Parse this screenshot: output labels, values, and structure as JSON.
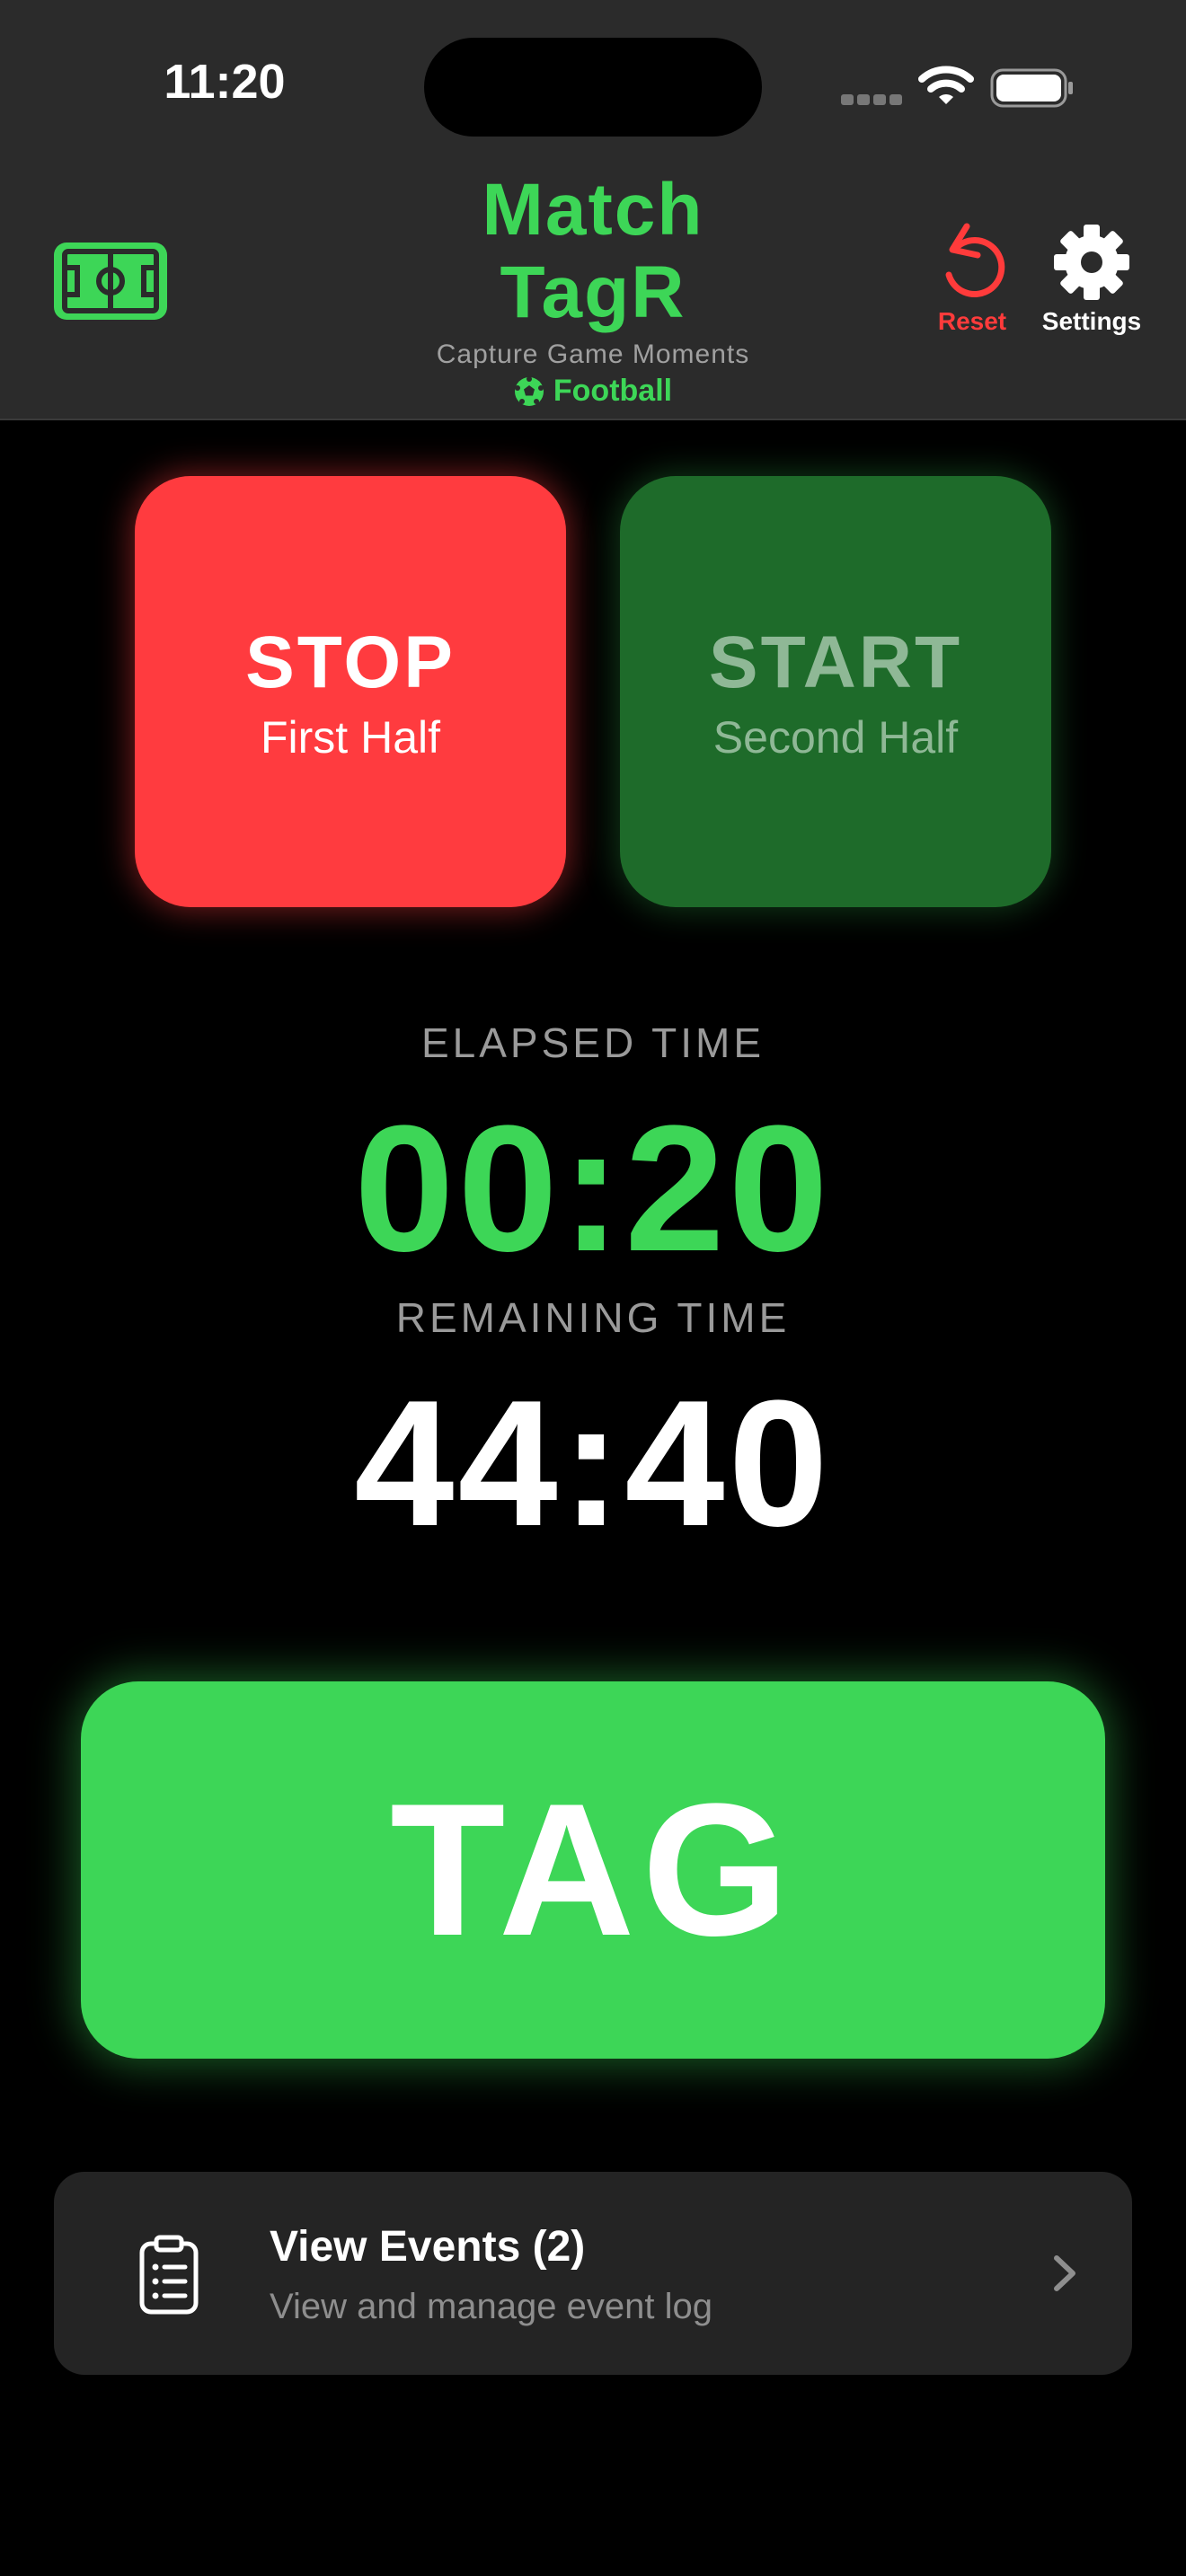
{
  "status_bar": {
    "time": "11:20"
  },
  "header": {
    "logo_icon": "football-pitch-icon",
    "title_line1": "Match",
    "title_line2": "TagR",
    "subtitle": "Capture Game Moments",
    "sport_icon": "soccer-ball-icon",
    "sport": "Football",
    "reset_label": "Reset",
    "settings_label": "Settings"
  },
  "halves": {
    "stop": {
      "main": "STOP",
      "sub": "First Half"
    },
    "start": {
      "main": "START",
      "sub": "Second Half"
    }
  },
  "timers": {
    "elapsed_caption": "ELAPSED TIME",
    "elapsed_value": "00:20",
    "remaining_caption": "REMAINING TIME",
    "remaining_value": "44:40"
  },
  "tag": {
    "label": "TAG"
  },
  "events": {
    "icon": "clipboard-list-icon",
    "title": "View Events (2)",
    "subtitle": "View and manage event log"
  },
  "colors": {
    "accent_green": "#3dd657",
    "stop_red": "#ff3b3f",
    "start_dark_green": "#1e6b2a",
    "header_bg": "#2b2b2b",
    "card_bg": "#242424"
  }
}
